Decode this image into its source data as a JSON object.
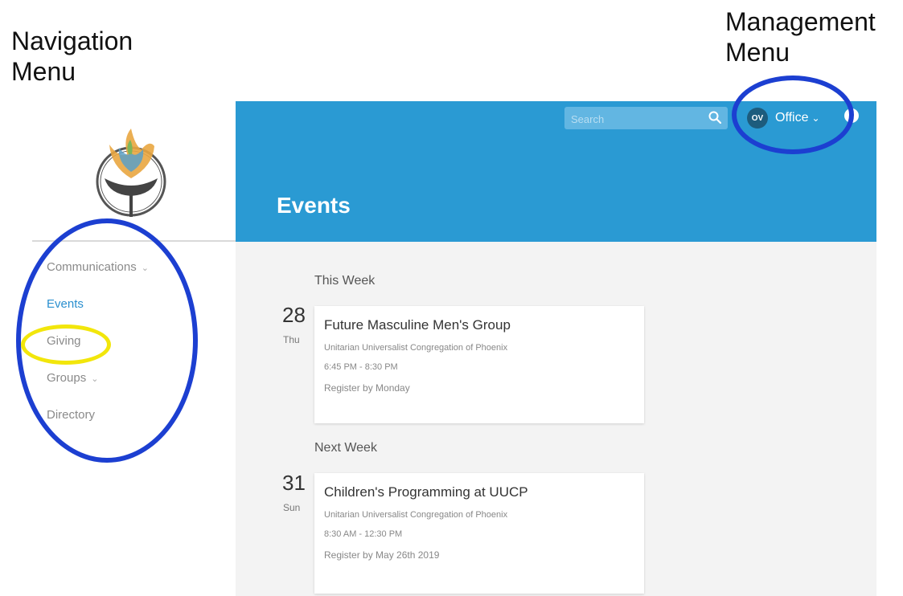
{
  "annotations": {
    "navigation": "Navigation\nMenu",
    "management": "Management\nMenu"
  },
  "nav": {
    "items": [
      {
        "label": "Communications",
        "has_dropdown": true
      },
      {
        "label": "Events",
        "active": true
      },
      {
        "label": "Giving"
      },
      {
        "label": "Groups",
        "has_dropdown": true
      },
      {
        "label": "Directory"
      }
    ],
    "chevron": "⌄"
  },
  "header": {
    "search_placeholder": "Search",
    "avatar_initials": "OV",
    "account_label": "Office",
    "account_chevron": "⌄",
    "title": "Events"
  },
  "events": {
    "sections": [
      {
        "label": "This Week",
        "date": "28",
        "day": "Thu",
        "title": "Future Masculine Men's Group",
        "org": "Unitarian Universalist Congregation of Phoenix",
        "time": "6:45 PM - 8:30 PM",
        "register": "Register by Monday"
      },
      {
        "label": "Next Week",
        "date": "31",
        "day": "Sun",
        "title": "Children's Programming at UUCP",
        "org": "Unitarian Universalist Congregation of Phoenix",
        "time": "8:30 AM - 12:30 PM",
        "register": "Register by May 26th 2019"
      }
    ]
  },
  "colors": {
    "header_bg": "#2a9ad3",
    "active_nav": "#2a8fcf",
    "annotation_blue": "#1c3fd1",
    "annotation_yellow": "#f2e60b"
  },
  "icons": [
    "chalice-logo",
    "search-icon",
    "help-icon",
    "chevron-down-icon"
  ]
}
